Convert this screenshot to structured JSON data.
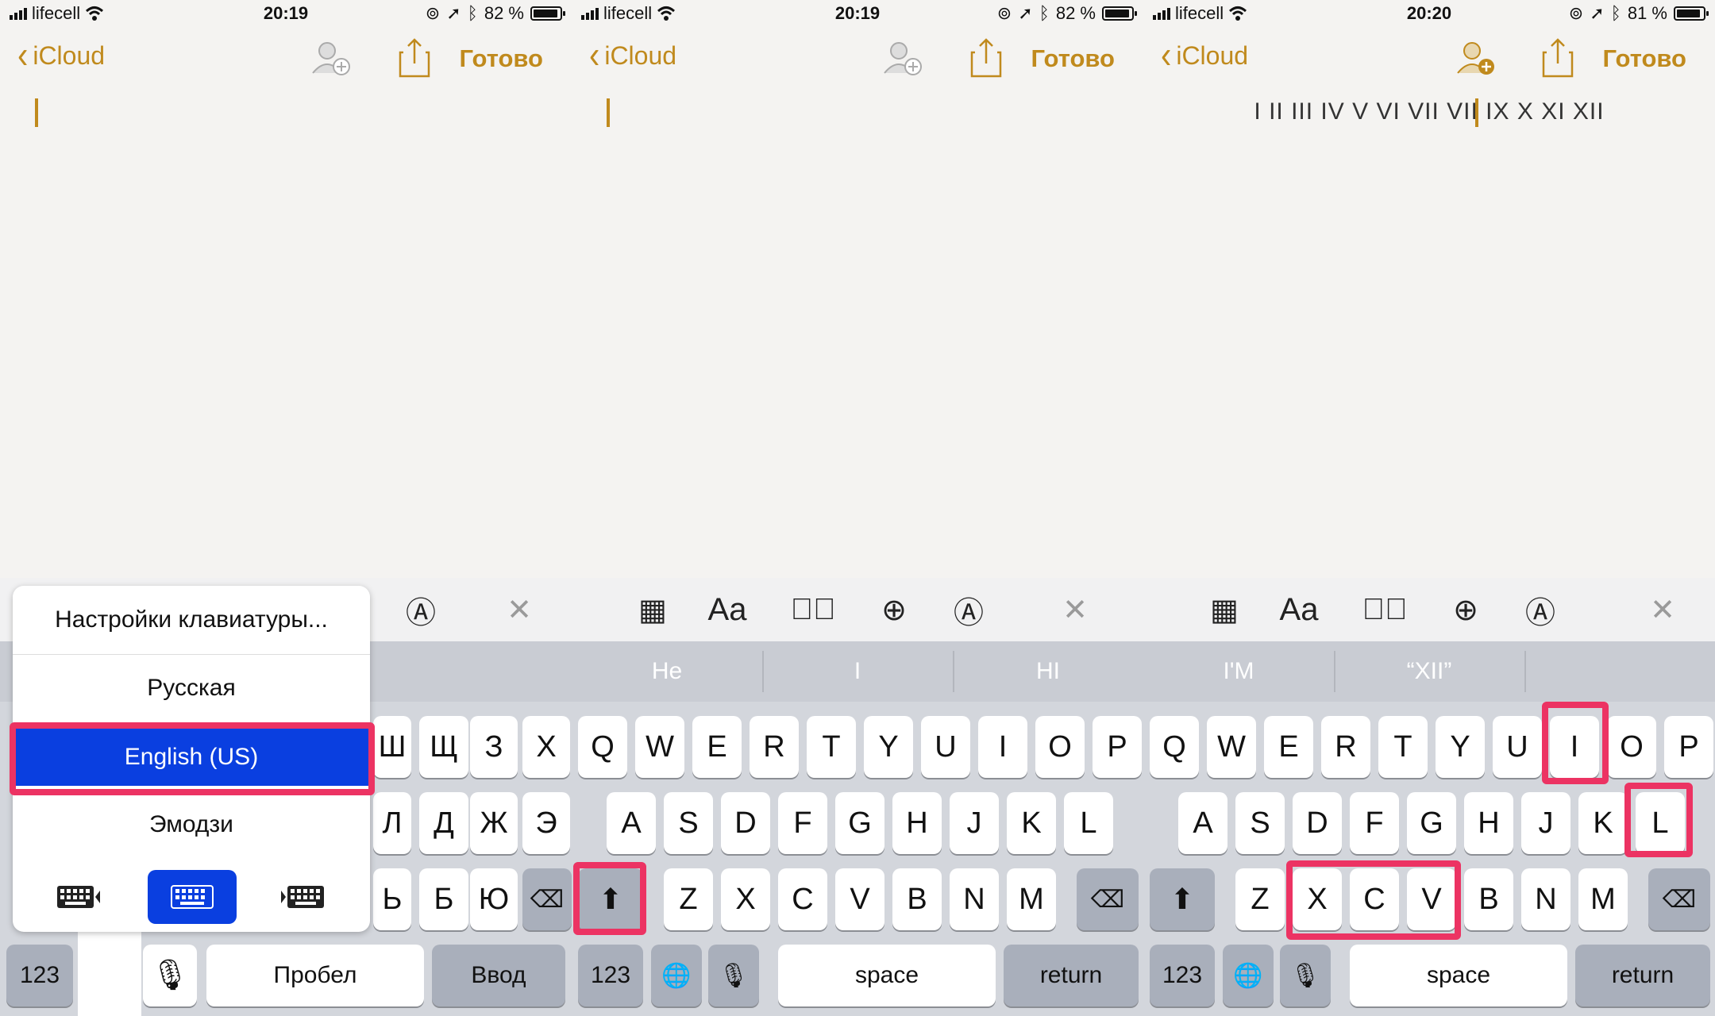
{
  "panels": [
    {
      "status": {
        "carrier": "lifecell",
        "time": "20:19",
        "battery": "82 %",
        "battery_level": 0.82
      },
      "nav": {
        "back_label": "iCloud",
        "done_label": "Готово"
      },
      "note": {
        "text": ""
      },
      "toolbar": {
        "icons": [
          "markup-icon",
          "close-icon"
        ]
      },
      "keys": {
        "row1": [
          "Ш",
          "Щ",
          "З",
          "Х"
        ],
        "row2": [
          "Л",
          "Д",
          "Ж",
          "Э"
        ],
        "row3": [
          "Ь",
          "Б",
          "Ю"
        ],
        "numbers": "123",
        "space": "Пробел",
        "return": "Ввод"
      },
      "keyboard_menu": {
        "items": [
          "Настройки клавиатуры...",
          "Русская",
          "English (US)",
          "Эмодзи"
        ],
        "selected": "English (US)"
      }
    },
    {
      "status": {
        "carrier": "lifecell",
        "time": "20:19",
        "battery": "82 %",
        "battery_level": 0.82
      },
      "nav": {
        "back_label": "iCloud",
        "done_label": "Готово"
      },
      "note": {
        "text": ""
      },
      "toolbar": {
        "icons": [
          "table-icon",
          "text-format-icon",
          "checklist-icon",
          "add-icon",
          "markup-icon",
          "close-icon"
        ],
        "aa_label": "Aa"
      },
      "suggestions": [
        "Не",
        "I",
        "HI",
        "I'M",
        "“XII”"
      ],
      "keys": {
        "row1": [
          "Q",
          "W",
          "E",
          "R",
          "T",
          "Y",
          "U",
          "I",
          "O",
          "P"
        ],
        "row2": [
          "A",
          "S",
          "D",
          "F",
          "G",
          "H",
          "J",
          "K",
          "L"
        ],
        "row3": [
          "Z",
          "X",
          "C",
          "V",
          "B",
          "N",
          "M"
        ],
        "numbers": "123",
        "space": "space",
        "return": "return"
      }
    },
    {
      "status": {
        "carrier": "lifecell",
        "time": "20:20",
        "battery": "81 %",
        "battery_level": 0.81
      },
      "nav": {
        "back_label": "iCloud",
        "done_label": "Готово"
      },
      "note": {
        "text": "I II III IV V VI VII VII IX X XI XII"
      },
      "toolbar": {
        "icons": [
          "table-icon",
          "text-format-icon",
          "checklist-icon",
          "add-icon",
          "markup-icon",
          "close-icon"
        ],
        "aa_label": "Aa"
      },
      "keys": {
        "row1": [
          "Q",
          "W",
          "E",
          "R",
          "T",
          "Y",
          "U",
          "I",
          "O",
          "P"
        ],
        "row2": [
          "A",
          "S",
          "D",
          "F",
          "G",
          "H",
          "J",
          "K",
          "L"
        ],
        "row3": [
          "Z",
          "X",
          "C",
          "V",
          "B",
          "N",
          "M"
        ],
        "numbers": "123",
        "space": "space",
        "return": "return"
      }
    }
  ],
  "colors": {
    "accent": "#c08a1d",
    "highlight": "#ec3363",
    "selected": "#0a3fe0"
  }
}
